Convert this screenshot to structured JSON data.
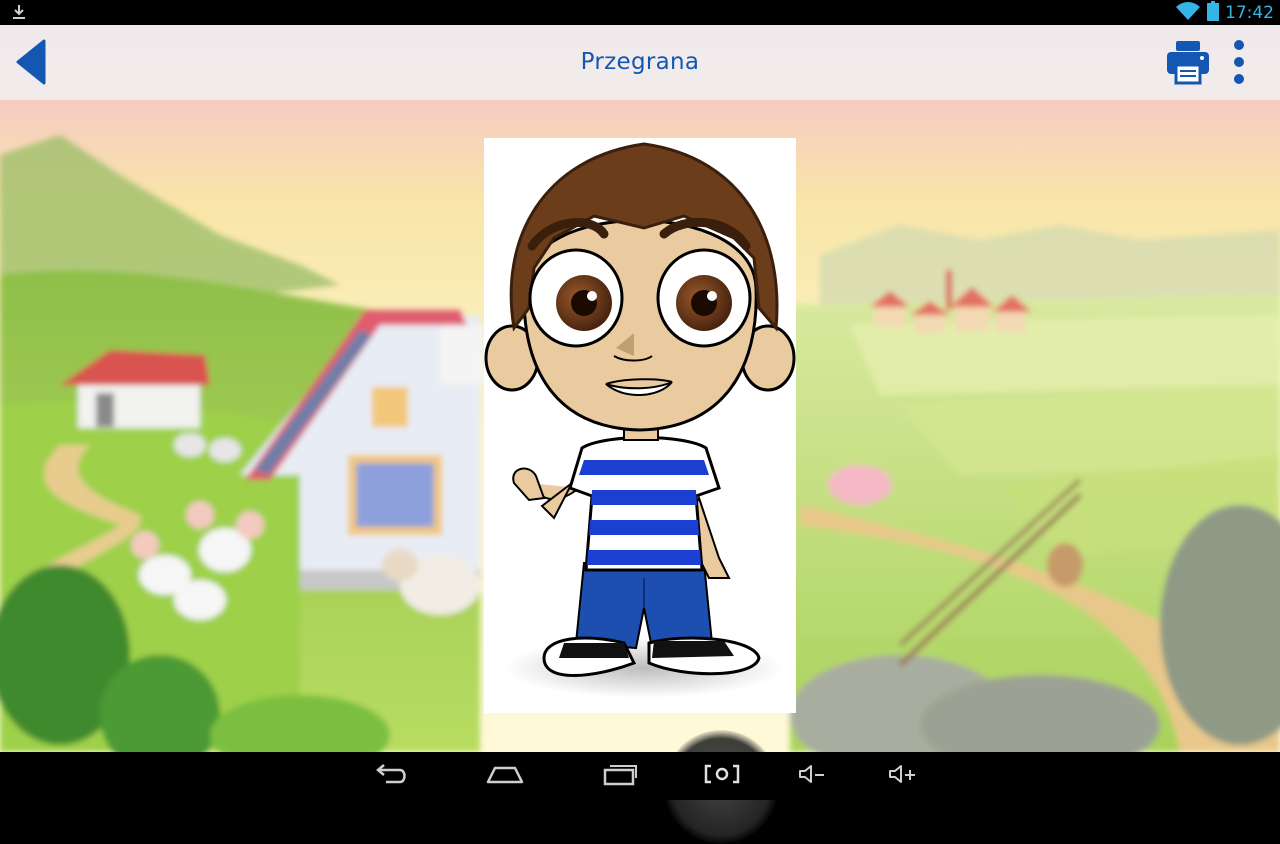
{
  "status_bar": {
    "time": "17:42",
    "icons": [
      "download-icon",
      "wifi-icon",
      "battery-icon"
    ]
  },
  "action_bar": {
    "title": "Przegrana",
    "icons": [
      "back-icon",
      "print-icon",
      "overflow-menu-icon"
    ],
    "accent_color": "#1357b3"
  },
  "nav_bar": {
    "icons": [
      "back-nav-icon",
      "home-nav-icon",
      "recent-apps-icon",
      "screenshot-icon",
      "volume-down-icon",
      "volume-up-icon"
    ]
  },
  "content": {
    "picture": "cartoon-boy-waving"
  }
}
